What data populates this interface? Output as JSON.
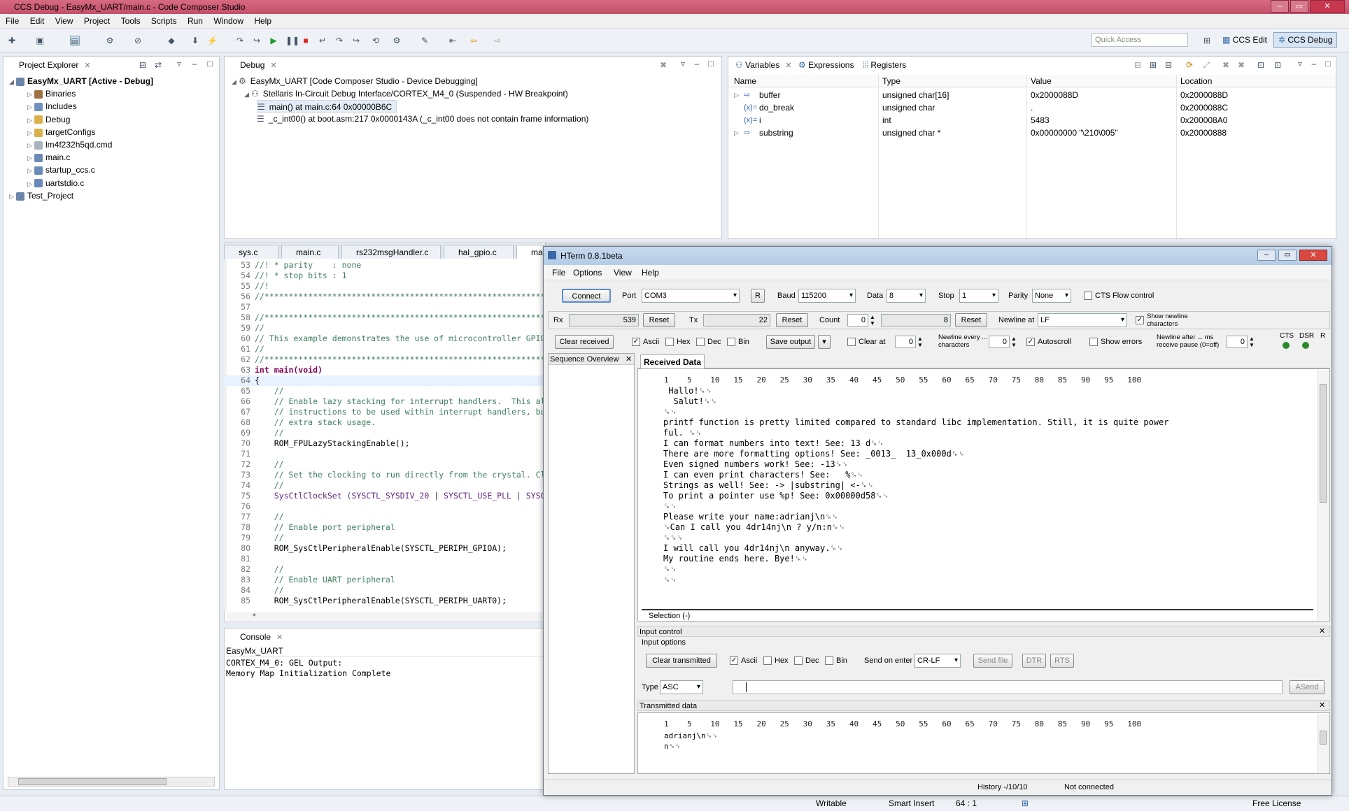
{
  "window": {
    "title": "CCS Debug - EasyMx_UART/main.c - Code Composer Studio",
    "minimize": "–",
    "maximize": "▭",
    "close": "✕"
  },
  "menu": [
    "File",
    "Edit",
    "View",
    "Project",
    "Tools",
    "Scripts",
    "Run",
    "Window",
    "Help"
  ],
  "toolbar": {
    "quick_access_placeholder": "Quick Access",
    "perspectives": [
      "CCS Edit",
      "CCS Debug"
    ]
  },
  "project_explorer": {
    "title": "Project Explorer",
    "items": [
      {
        "label": "EasyMx_UART  [Active - Debug]",
        "level": 0,
        "expanded": true,
        "icon": "project-icon"
      },
      {
        "label": "Binaries",
        "level": 1,
        "icon": "binaries-icon"
      },
      {
        "label": "Includes",
        "level": 1,
        "icon": "includes-icon"
      },
      {
        "label": "Debug",
        "level": 1,
        "icon": "folder-icon"
      },
      {
        "label": "targetConfigs",
        "level": 1,
        "icon": "folder-icon"
      },
      {
        "label": "lm4f232h5qd.cmd",
        "level": 1,
        "icon": "file-icon"
      },
      {
        "label": "main.c",
        "level": 1,
        "icon": "c-file-icon"
      },
      {
        "label": "startup_ccs.c",
        "level": 1,
        "icon": "c-file-icon"
      },
      {
        "label": "uartstdio.c",
        "level": 1,
        "icon": "c-file-icon"
      },
      {
        "label": "Test_Project",
        "level": 0,
        "icon": "project-icon"
      }
    ]
  },
  "debug": {
    "title": "Debug",
    "rows": [
      {
        "label": "EasyMx_UART [Code Composer Studio - Device Debugging]",
        "level": 0
      },
      {
        "label": "Stellaris In-Circuit Debug Interface/CORTEX_M4_0 (Suspended - HW Breakpoint)",
        "level": 1
      },
      {
        "label": "main() at main.c:64 0x00000B6C",
        "level": 2,
        "selected": true
      },
      {
        "label": "_c_int00() at boot.asm:217 0x0000143A  (_c_int00 does not contain frame information)",
        "level": 2
      }
    ]
  },
  "variables": {
    "tabs": [
      "Variables",
      "Expressions",
      "Registers"
    ],
    "columns": [
      "Name",
      "Type",
      "Value",
      "Location"
    ],
    "rows": [
      {
        "name": "buffer",
        "type": "unsigned char[16]",
        "value": "0x2000088D",
        "location": "0x2000088D",
        "expandable": true
      },
      {
        "name": "do_break",
        "type": "unsigned char",
        "value": ".",
        "location": "0x2000088C",
        "expandable": false
      },
      {
        "name": "i",
        "type": "int",
        "value": "5483",
        "location": "0x200008A0",
        "expandable": false
      },
      {
        "name": "substring",
        "type": "unsigned char *",
        "value": "0x00000000 \"\\210\\005\"",
        "location": "0x20000888",
        "expandable": true
      }
    ]
  },
  "editor": {
    "tabs": [
      "sys.c",
      "main.c",
      "rs232msgHandler.c",
      "hal_gpio.c",
      "ma"
    ],
    "lines": [
      {
        "n": "53",
        "t": "//! * parity    : none",
        "c": "cmt"
      },
      {
        "n": "54",
        "t": "//! * stop bits : 1",
        "c": "cmt"
      },
      {
        "n": "55",
        "t": "//!",
        "c": "cmt"
      },
      {
        "n": "56",
        "t": "//*****************************************************************************",
        "c": "cmt"
      },
      {
        "n": "57",
        "t": "",
        "c": ""
      },
      {
        "n": "58",
        "t": "//*****************************************************************************",
        "c": "cmt"
      },
      {
        "n": "59",
        "t": "//",
        "c": "cmt"
      },
      {
        "n": "60",
        "t": "// This example demonstrates the use of microcontroller GPIO",
        "c": "cmt"
      },
      {
        "n": "61",
        "t": "//",
        "c": "cmt"
      },
      {
        "n": "62",
        "t": "//*****************************************************************************",
        "c": "cmt"
      },
      {
        "n": "63",
        "t": "int main(void)",
        "c": "kw"
      },
      {
        "n": "64",
        "t": "{",
        "c": "cur"
      },
      {
        "n": "65",
        "t": "    //",
        "c": "cmt"
      },
      {
        "n": "66",
        "t": "    // Enable lazy stacking for interrupt handlers.  This al",
        "c": "cmt"
      },
      {
        "n": "67",
        "t": "    // instructions to be used within interrupt handlers, bu",
        "c": "cmt"
      },
      {
        "n": "68",
        "t": "    // extra stack usage.",
        "c": "cmt"
      },
      {
        "n": "69",
        "t": "    //",
        "c": "cmt"
      },
      {
        "n": "70",
        "t": "    ROM_FPULazyStackingEnable();",
        "c": ""
      },
      {
        "n": "71",
        "t": "",
        "c": ""
      },
      {
        "n": "72",
        "t": "    //",
        "c": "cmt"
      },
      {
        "n": "73",
        "t": "    // Set the clocking to run directly from the crystal. Cl",
        "c": "cmt"
      },
      {
        "n": "74",
        "t": "    //",
        "c": "cmt"
      },
      {
        "n": "75",
        "t": "    SysCtlClockSet (SYSCTL_SYSDIV_20 | SYSCTL_USE_PLL | SYSC",
        "c": "fn"
      },
      {
        "n": "76",
        "t": "",
        "c": ""
      },
      {
        "n": "77",
        "t": "    //",
        "c": "cmt"
      },
      {
        "n": "78",
        "t": "    // Enable port peripheral",
        "c": "cmt"
      },
      {
        "n": "79",
        "t": "    //",
        "c": "cmt"
      },
      {
        "n": "80",
        "t": "    ROM_SysCtlPeripheralEnable(SYSCTL_PERIPH_GPIOA);",
        "c": ""
      },
      {
        "n": "81",
        "t": "",
        "c": ""
      },
      {
        "n": "82",
        "t": "    //",
        "c": "cmt"
      },
      {
        "n": "83",
        "t": "    // Enable UART peripheral",
        "c": "cmt"
      },
      {
        "n": "84",
        "t": "    //",
        "c": "cmt"
      },
      {
        "n": "85",
        "t": "    ROM_SysCtlPeripheralEnable(SYSCTL_PERIPH_UART0);",
        "c": ""
      }
    ]
  },
  "console": {
    "title": "Console",
    "subtitle": "EasyMx_UART",
    "lines": [
      "CORTEX_M4_0: GEL Output:",
      "Memory Map Initialization Complete"
    ]
  },
  "hterm": {
    "title": "HTerm 0.8.1beta",
    "menu": [
      "File",
      "Options",
      "View",
      "Help"
    ],
    "connect": "Connect",
    "port_label": "Port",
    "port": "COM3",
    "r_button": "R",
    "baud_label": "Baud",
    "baud": "115200",
    "data_label": "Data",
    "data": "8",
    "stop_label": "Stop",
    "stop": "1",
    "parity_label": "Parity",
    "parity": "None",
    "cts_flow": "CTS Flow control",
    "rx_label": "Rx",
    "rx": "539",
    "tx_label": "Tx",
    "tx": "22",
    "reset": "Reset",
    "count_label": "Count",
    "count": "0",
    "count_max": "8",
    "newline_at_label": "Newline at",
    "newline_at": "LF",
    "show_newline": "Show newline characters",
    "clear_received": "Clear received",
    "ascii": "Ascii",
    "hex": "Hex",
    "dec": "Dec",
    "bin": "Bin",
    "save_output": "Save output",
    "clear_at": "Clear at",
    "clear_at_value": "0",
    "newline_every": "Newline every ... characters",
    "newline_every_value": "0",
    "autoscroll": "Autoscroll",
    "show_errors": "Show errors",
    "newline_after": "Newline after ... ms receive pause (0=off)",
    "newline_after_value": "0",
    "cts": "CTS",
    "dsr": "DSR",
    "ri": "R",
    "sequence_overview": "Sequence Overview",
    "received_tab": "Received Data",
    "ruler": "1    5    10   15   20   25   30   35   40   45   50   55   60   65   70   75   80   85   90   95   100",
    "received_lines": [
      " Hallo!␍␊",
      "  Salut!␍␊",
      "␍␊",
      "printf function is pretty limited compared to standard libc implementation. Still, it is quite power",
      "ful. ␍␊",
      "I can format numbers into text! See: 13 d␍␊",
      "There are more formatting options! See: _0013_  13_0x000d␍␊",
      "Even signed numbers work! See: -13␍␊",
      "I can even print characters! See:   %␍␊",
      "Strings as well! See: -> |substring| <-␍␊",
      "To print a pointer use %p! See: 0x00000d58␍␊",
      "␍␊",
      "Please write your name:adrianj\\n␍␊",
      "␍Can I call you 4dr14nj\\n ? y/n:n␍␊",
      "␍␍␊",
      "I will call you 4dr14nj\\n anyway.␍␊",
      "My routine ends here. Bye!␍␊",
      "␍␊",
      "␍␊"
    ],
    "selection": "Selection (-)",
    "input_control": "Input control",
    "input_options": "Input options",
    "clear_transmitted": "Clear transmitted",
    "send_on_enter_label": "Send on enter",
    "send_on_enter": "CR-LF",
    "send_file": "Send file",
    "dtr": "DTR",
    "rts": "RTS",
    "type_label": "Type",
    "type": "ASC",
    "asend": "ASend",
    "input_value": "",
    "transmitted_title": "Transmitted data",
    "transmitted_lines": [
      "adrianj\\n␍␊",
      "n␍␊"
    ],
    "history": "History -/10/10",
    "status": "Not connected"
  },
  "statusbar": {
    "writable": "Writable",
    "insert": "Smart Insert",
    "position": "64 : 1",
    "license": "Free License"
  }
}
